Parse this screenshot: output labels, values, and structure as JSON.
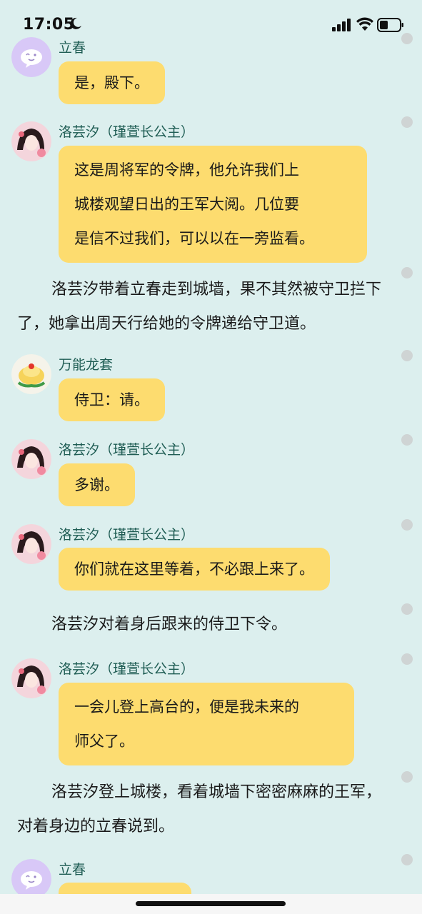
{
  "status_bar": {
    "time": "17:05"
  },
  "messages": [
    {
      "type": "chat",
      "speaker": "立春",
      "avatar": "lichun",
      "lines": [
        "是，殿下。"
      ]
    },
    {
      "type": "chat",
      "speaker": "洛芸汐（瑾萱长公主）",
      "avatar": "princess",
      "lines": [
        "这是周将军的令牌，他允许我们上",
        "城楼观望日出的王军大阅。几位要",
        "是信不过我们，可以以在一旁监看。"
      ]
    },
    {
      "type": "narration",
      "text": "洛芸汐带着立春走到城墙，果不其然被守卫拦下了，她拿出周天行给她的令牌递给守卫道。"
    },
    {
      "type": "chat",
      "speaker": "万能龙套",
      "avatar": "extra",
      "lines": [
        "侍卫：请。"
      ]
    },
    {
      "type": "chat",
      "speaker": "洛芸汐（瑾萱长公主）",
      "avatar": "princess",
      "lines": [
        "多谢。"
      ]
    },
    {
      "type": "chat",
      "speaker": "洛芸汐（瑾萱长公主）",
      "avatar": "princess",
      "lines": [
        "你们就在这里等着，不必跟上来了。"
      ]
    },
    {
      "type": "narration",
      "text": "洛芸汐对着身后跟来的侍卫下令。"
    },
    {
      "type": "chat",
      "speaker": "洛芸汐（瑾萱长公主）",
      "avatar": "princess",
      "lines": [
        "一会儿登上高台的，便是我未来的",
        "师父了。"
      ]
    },
    {
      "type": "narration",
      "text": "洛芸汐登上城楼，看着城墙下密密麻麻的王军，对着身边的立春说到。"
    },
    {
      "type": "chat",
      "speaker": "立春",
      "avatar": "lichun",
      "lines": [
        ""
      ]
    }
  ],
  "colors": {
    "background": "#dcefee",
    "bubble": "#fddc6f",
    "speaker_name": "#1f5d54",
    "dot": "#cfd4d4"
  }
}
